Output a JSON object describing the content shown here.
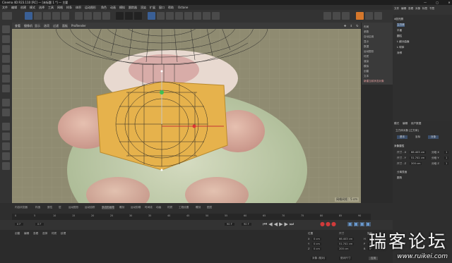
{
  "window": {
    "title": "Cinema 4D R23.110 [RC] — [未标题 1 *] — 主要"
  },
  "menu": [
    "文件",
    "编辑",
    "创建",
    "模式",
    "选择",
    "工具",
    "网格",
    "样条",
    "体积",
    "运动图形",
    "角色",
    "动画",
    "模拟",
    "跟踪器",
    "渲染",
    "扩展",
    "窗口",
    "帮助",
    "Octane"
  ],
  "layout_label": "界面: 启动",
  "viewport": {
    "menu": [
      "查看",
      "摄像机",
      "显示",
      "选项",
      "过滤",
      "面板",
      "ProRender"
    ],
    "status_text": "网格间距：5 cm"
  },
  "context_menu": [
    "布局",
    "参数",
    "自动启用",
    "显示",
    "数据",
    "运动图形",
    "材质",
    "渲染",
    "模拟",
    "创建",
    "文本",
    "新建当前状态对象"
  ],
  "objects": {
    "header": [
      "文件",
      "编辑",
      "查看",
      "对象",
      "标签",
      "书签"
    ],
    "items": [
      "4倍光照",
      "立方体",
      "平面",
      "圆柱",
      "L 细分曲面",
      "L 球体",
      "对称"
    ]
  },
  "attributes": {
    "header": [
      "模式",
      "编辑",
      "用户数据"
    ],
    "title": "立方体对象 [立方体]",
    "tabs": [
      "基本",
      "坐标",
      "对象"
    ],
    "section": "对象属性",
    "fields": [
      {
        "label": "尺寸 . X",
        "value": "66.403 cm",
        "seg_label": "分段 X",
        "seg": "1"
      },
      {
        "label": "尺寸 . Y",
        "value": "51.741 cm",
        "seg_label": "分段 Y",
        "seg": "1"
      },
      {
        "label": "尺寸 . Z",
        "value": "200 cm",
        "seg_label": "分段 Z",
        "seg": "1"
      }
    ],
    "checks": [
      "分离表面",
      "圆角"
    ]
  },
  "timeline": {
    "tabs": [
      "内容浏览器",
      "构造",
      "属性",
      "层",
      "运动图形",
      "运动追踪",
      "多边形画笔",
      "雕刻",
      "运动剪辑",
      "时间线",
      "动画",
      "材质",
      "工程设置",
      "雕刻",
      "图层"
    ],
    "ticks": [
      "0",
      "5",
      "10",
      "15",
      "20",
      "25",
      "30",
      "35",
      "40",
      "45",
      "50",
      "55",
      "60",
      "65",
      "70",
      "75",
      "80",
      "85",
      "90"
    ],
    "current_frame": "0 F",
    "start": "0 F",
    "end": "90 F",
    "end2": "90 F"
  },
  "materials": {
    "menu": [
      "创建",
      "编辑",
      "查看",
      "选择",
      "材质",
      "纹理"
    ]
  },
  "coords": {
    "header": [
      "位置",
      "尺寸",
      "旋转"
    ],
    "rows": [
      {
        "axis": "X",
        "pos": "0 cm",
        "size": "66.403 cm",
        "rot_axis": "H",
        "rot": "0°"
      },
      {
        "axis": "Y",
        "pos": "0 cm",
        "size": "51.741 cm",
        "rot_axis": "P",
        "rot": "0°"
      },
      {
        "axis": "Z",
        "pos": "0 cm",
        "size": "200 cm",
        "rot_axis": "B",
        "rot": "0°"
      }
    ],
    "mode": "对象 (相对)",
    "size_mode": "绝对尺寸",
    "apply": "应用"
  },
  "watermark": {
    "cn": "瑞客论坛",
    "url": "www.ruikei.com"
  },
  "colors": {
    "accent": "#3a5f95",
    "viewport_bg": "#8f8b71",
    "book": "#e6b24c",
    "character_green": "#b7c6a4"
  }
}
